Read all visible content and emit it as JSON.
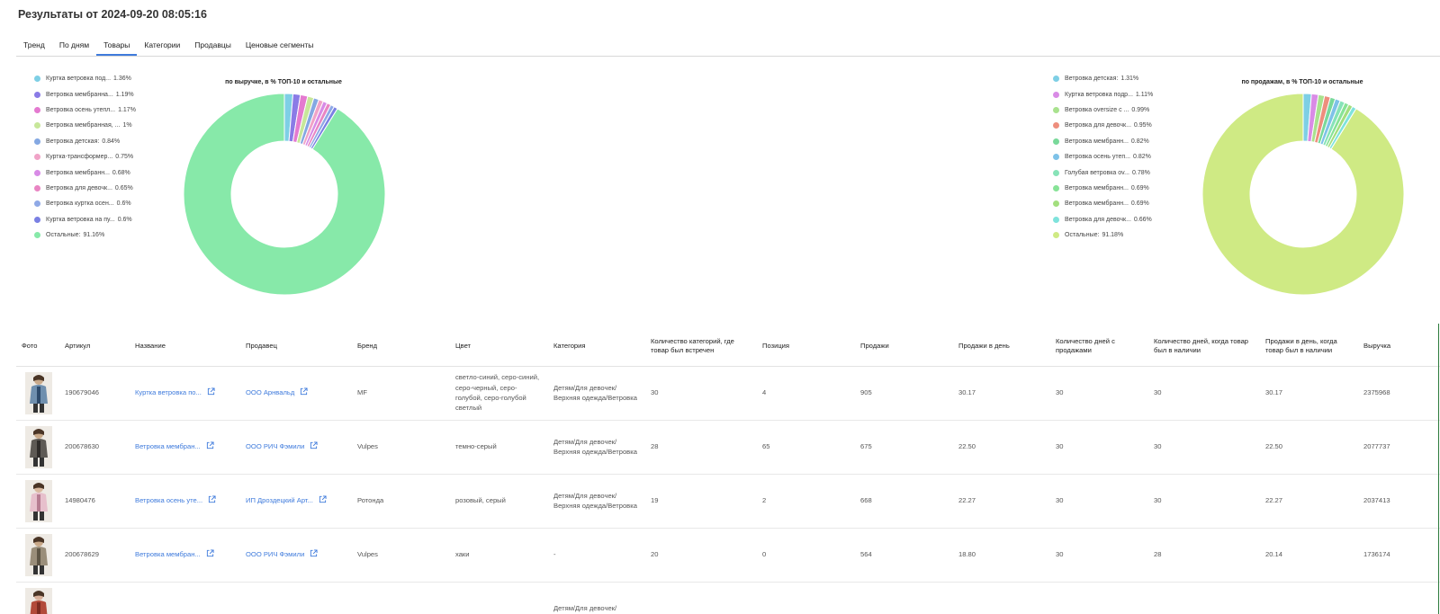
{
  "header": {
    "title": "Результаты от 2024-09-20 08:05:16"
  },
  "tabs": [
    {
      "label": "Тренд",
      "active": false
    },
    {
      "label": "По дням",
      "active": false
    },
    {
      "label": "Товары",
      "active": true
    },
    {
      "label": "Категории",
      "active": false
    },
    {
      "label": "Продавцы",
      "active": false
    },
    {
      "label": "Ценовые сегменты",
      "active": false
    }
  ],
  "charts": [
    {
      "title": "по выручке, в % ТОП-10 и остальные",
      "legend": [
        {
          "label": "Куртка ветровка под...",
          "value": "1.36%",
          "color": "#7ecfe5"
        },
        {
          "label": "Ветровка мембранна...",
          "value": "1.19%",
          "color": "#8a7be6"
        },
        {
          "label": "Ветровка осень утепл...",
          "value": "1.17%",
          "color": "#e47ad0"
        },
        {
          "label": "Ветровка мембранная, ...",
          "value": "1%",
          "color": "#c7e79a"
        },
        {
          "label": "Ветровка детская:",
          "value": "0.84%",
          "color": "#84a8e2"
        },
        {
          "label": "Куртка-трансформер...",
          "value": "0.75%",
          "color": "#f0a3c7"
        },
        {
          "label": "Ветровка мембранн...",
          "value": "0.68%",
          "color": "#d88be6"
        },
        {
          "label": "Ветровка для девочк...",
          "value": "0.65%",
          "color": "#e985c3"
        },
        {
          "label": "Ветровка куртка осен...",
          "value": "0.6%",
          "color": "#8fa9e6"
        },
        {
          "label": "Куртка ветровка на пу...",
          "value": "0.6%",
          "color": "#7a80e3"
        },
        {
          "label": "Остальные:",
          "value": "91.16%",
          "color": "#87e9a9"
        }
      ]
    },
    {
      "title": "по продажам, в % ТОП-10 и остальные",
      "legend": [
        {
          "label": "Ветровка детская:",
          "value": "1.31%",
          "color": "#7ecfe5"
        },
        {
          "label": "Куртка ветровка подр...",
          "value": "1.11%",
          "color": "#d98be6"
        },
        {
          "label": "Ветровка oversize с ...",
          "value": "0.99%",
          "color": "#a9e28e"
        },
        {
          "label": "Ветровка для девочк...",
          "value": "0.95%",
          "color": "#ee8e7d"
        },
        {
          "label": "Ветровка мембранн...",
          "value": "0.82%",
          "color": "#79d99a"
        },
        {
          "label": "Ветровка осень утеп...",
          "value": "0.82%",
          "color": "#7ec2e8"
        },
        {
          "label": "Голубая ветровка ov...",
          "value": "0.78%",
          "color": "#87e3b8"
        },
        {
          "label": "Ветровка мембранн...",
          "value": "0.69%",
          "color": "#87e397"
        },
        {
          "label": "Ветровка мембранн...",
          "value": "0.69%",
          "color": "#a3df7e"
        },
        {
          "label": "Ветровка для девочк...",
          "value": "0.66%",
          "color": "#7fe3dc"
        },
        {
          "label": "Остальные:",
          "value": "91.18%",
          "color": "#cfea84"
        }
      ]
    }
  ],
  "chart_data": [
    {
      "type": "pie",
      "title": "по выручке, в % ТОП-10 и остальные",
      "categories": [
        "Куртка ветровка под...",
        "Ветровка мембранна...",
        "Ветровка осень утепл...",
        "Ветровка мембранная, ...",
        "Ветровка детская:",
        "Куртка-трансформер...",
        "Ветровка мембранн...",
        "Ветровка для девочк...",
        "Ветровка куртка осен...",
        "Куртка ветровка на пу...",
        "Остальные:"
      ],
      "values": [
        1.36,
        1.19,
        1.17,
        1.0,
        0.84,
        0.75,
        0.68,
        0.65,
        0.6,
        0.6,
        91.16
      ],
      "legend": "left"
    },
    {
      "type": "pie",
      "title": "по продажам, в % ТОП-10 и остальные",
      "categories": [
        "Ветровка детская:",
        "Куртка ветровка подр...",
        "Ветровка oversize с ...",
        "Ветровка для девочк...",
        "Ветровка мембранн...",
        "Ветровка осень утеп...",
        "Голубая ветровка ov...",
        "Ветровка мембранн...",
        "Ветровка мембранн...",
        "Ветровка для девочк...",
        "Остальные:"
      ],
      "values": [
        1.31,
        1.11,
        0.99,
        0.95,
        0.82,
        0.82,
        0.78,
        0.69,
        0.69,
        0.66,
        91.18
      ],
      "legend": "left"
    }
  ],
  "table": {
    "columns": [
      "Фото",
      "Артикул",
      "Название",
      "Продавец",
      "Бренд",
      "Цвет",
      "Категория",
      "Количество категорий, где товар был встречен",
      "Позиция",
      "Продажи",
      "Продажи в день",
      "Количество дней с продажами",
      "Количество дней, когда товар был в наличии",
      "Продажи в день, когда товар был в наличии",
      "Выручка"
    ],
    "rows": [
      {
        "photo": "photo-1",
        "article": "190679046",
        "name": "Куртка ветровка по...",
        "seller": "ООО Арнвальд",
        "brand": "MF",
        "color": "светло-синий, серо-синий, серо-черный, серо-голубой, серо-голубой светлый",
        "category": "Детям/Для девочек/Верхняя одежда/Ветровка",
        "cat_count": "30",
        "position": "4",
        "sales": "905",
        "sales_per_day": "30.17",
        "days_with_sales": "30",
        "days_in_stock": "30",
        "sales_per_day_in_stock": "30.17",
        "revenue": "2375968"
      },
      {
        "photo": "photo-2",
        "article": "200678630",
        "name": "Ветровка мембран...",
        "seller": "ООО РИЧ Фэмили",
        "brand": "Vulpes",
        "color": "темно-серый",
        "category": "Детям/Для девочек/Верхняя одежда/Ветровка",
        "cat_count": "28",
        "position": "65",
        "sales": "675",
        "sales_per_day": "22.50",
        "days_with_sales": "30",
        "days_in_stock": "30",
        "sales_per_day_in_stock": "22.50",
        "revenue": "2077737"
      },
      {
        "photo": "photo-3",
        "article": "14980476",
        "name": "Ветровка осень уте...",
        "seller": "ИП Дроздецкий Арт...",
        "brand": "Ротонда",
        "color": "розовый, серый",
        "category": "Детям/Для девочек/Верхняя одежда/Ветровка",
        "cat_count": "19",
        "position": "2",
        "sales": "668",
        "sales_per_day": "22.27",
        "days_with_sales": "30",
        "days_in_stock": "30",
        "sales_per_day_in_stock": "22.27",
        "revenue": "2037413"
      },
      {
        "photo": "photo-4",
        "article": "200678629",
        "name": "Ветровка мембран...",
        "seller": "ООО РИЧ Фэмили",
        "brand": "Vulpes",
        "color": "хаки",
        "category": "-",
        "cat_count": "20",
        "position": "0",
        "sales": "564",
        "sales_per_day": "18.80",
        "days_with_sales": "30",
        "days_in_stock": "28",
        "sales_per_day_in_stock": "20.14",
        "revenue": "1736174"
      },
      {
        "photo": "photo-5",
        "article": "",
        "name": "",
        "seller": "",
        "brand": "",
        "color": "",
        "category": "Детям/Для девочек/",
        "cat_count": "",
        "position": "",
        "sales": "",
        "sales_per_day": "",
        "days_with_sales": "",
        "days_in_stock": "",
        "sales_per_day_in_stock": "",
        "revenue": ""
      }
    ]
  },
  "icons": {
    "link": "external-link-icon"
  },
  "colors": {
    "accent": "#3f7bdc",
    "tab_underline": "#3f7bdc",
    "right_border": "#2c7a3b"
  }
}
